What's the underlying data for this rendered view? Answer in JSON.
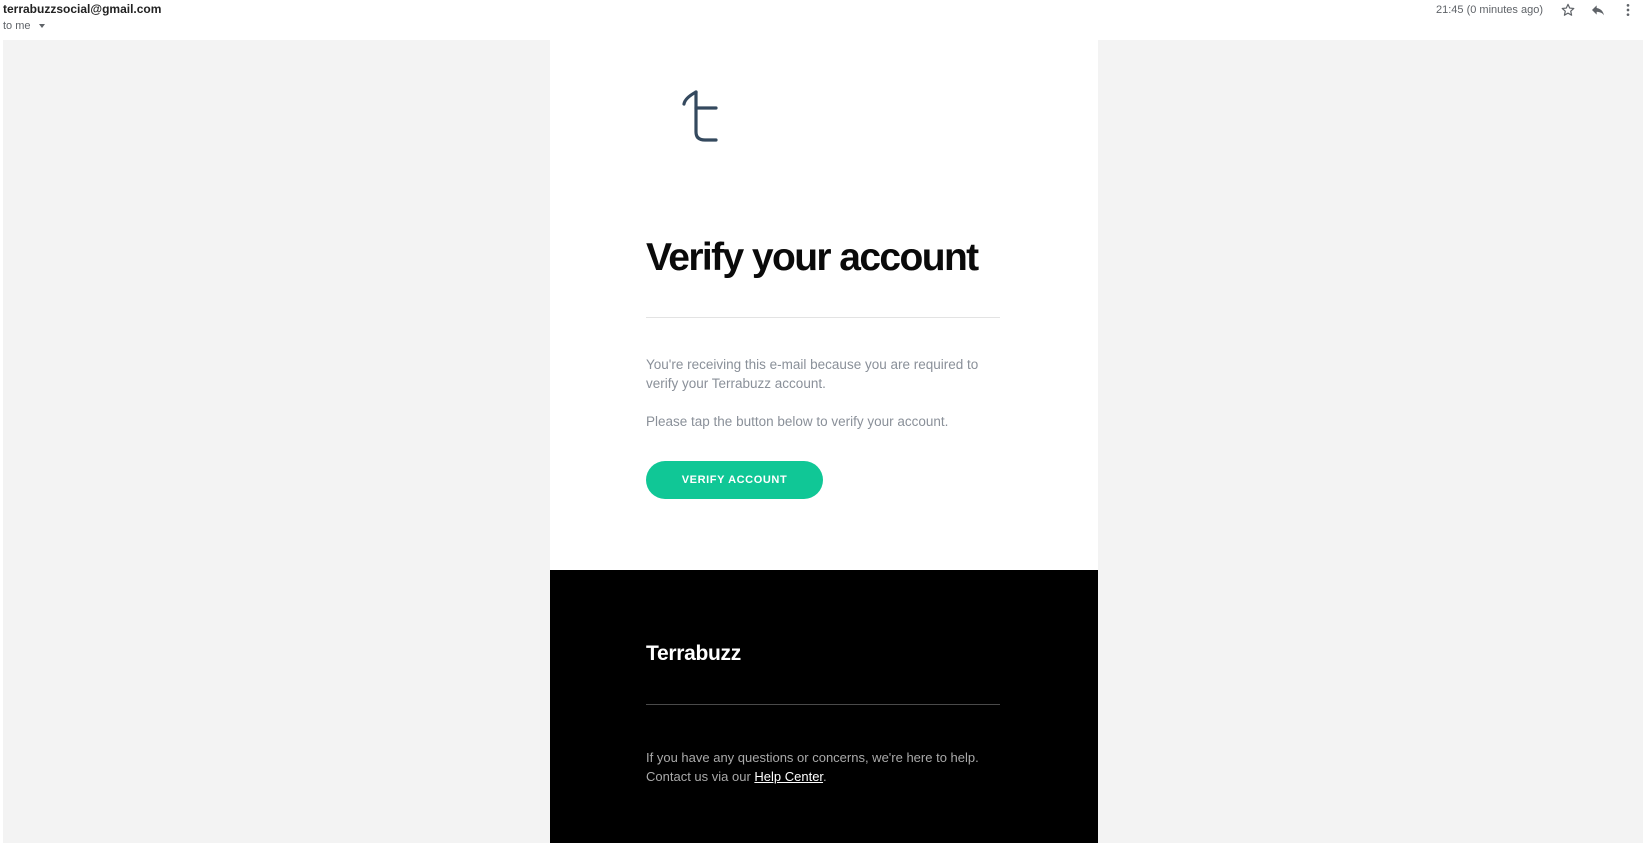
{
  "header": {
    "sender": "terrabuzzsocial@gmail.com",
    "recipient": "to me",
    "timestamp": "21:45 (0 minutes ago)",
    "icons": [
      "star-icon",
      "reply-icon",
      "more-vert-icon"
    ]
  },
  "email": {
    "logo": "t",
    "title": "Verify your account",
    "paragraph1": "You're receiving this e-mail because you are required to verify your Terrabuzz account.",
    "paragraph2": "Please tap the button below to verify your account.",
    "button_label": "VERIFY ACCOUNT",
    "footer": {
      "brand": "Terrabuzz",
      "line1": "If you have any questions or concerns, we're here to help.",
      "line2_prefix": "Contact us via our ",
      "link_text": "Help Center",
      "line2_suffix": "."
    }
  },
  "colors": {
    "accent": "#10c796",
    "canvas_background": "#f3f3f3",
    "footer_background": "#000000",
    "logo": "#34495e",
    "body_text": "#8a9099"
  }
}
